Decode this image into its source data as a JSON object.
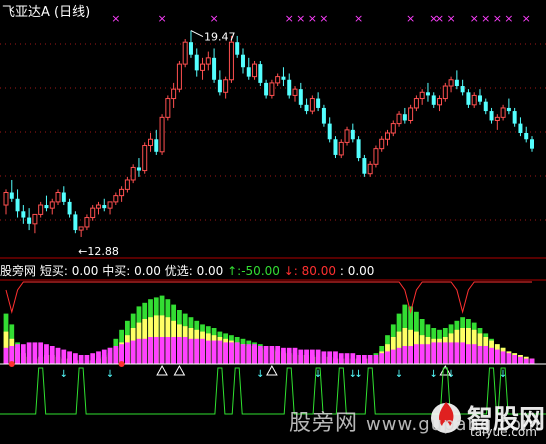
{
  "window": {
    "title": "飞亚达A (日线)"
  },
  "indicator_bar": {
    "name": "股旁网",
    "short_label": "短买:",
    "short_value": "0.00",
    "mid_label": "中买:",
    "mid_value": "0.00",
    "pick_label": "优选:",
    "pick_value": "0.00",
    "up_arrow": "↑",
    "up_value": ":-50.00",
    "down_arrow": "↓",
    "down_value": ": 80.00",
    "last_value": ": 0.00"
  },
  "watermark": {
    "site_cn": "股旁网",
    "site_url": "www.gupang.com",
    "brand_cn": "智股网",
    "brand_url": "taiyue.com"
  },
  "colors": {
    "up_candle": "#ff5050",
    "down_candle": "#54ffff",
    "magenta": "#ff40ff",
    "yellow": "#ffff66",
    "green": "#33dd33",
    "red_line": "#ff3030",
    "signal_line": "#30e030",
    "grid": "#a01818",
    "axis": "#b00000"
  },
  "chart_data": [
    {
      "type": "candlestick",
      "title": "飞亚达A (日线)",
      "annotations": [
        {
          "text": "19.47",
          "at_index": 32,
          "kind": "high"
        },
        {
          "text": "12.88",
          "at_index": 13,
          "kind": "low"
        }
      ],
      "top_markers_at": [
        19,
        27,
        36,
        49,
        51,
        53,
        55,
        61,
        70,
        74,
        75,
        77,
        81,
        83,
        85,
        87,
        90
      ],
      "candles": [
        [
          13.9,
          14.4,
          13.6,
          14.3
        ],
        [
          14.3,
          14.7,
          14.0,
          14.1
        ],
        [
          14.1,
          14.4,
          13.5,
          13.7
        ],
        [
          13.7,
          13.9,
          13.3,
          13.5
        ],
        [
          13.5,
          13.8,
          13.1,
          13.3
        ],
        [
          13.3,
          13.6,
          13.0,
          13.6
        ],
        [
          13.6,
          14.0,
          13.5,
          13.9
        ],
        [
          13.9,
          14.2,
          13.7,
          13.8
        ],
        [
          13.8,
          14.1,
          13.6,
          14.0
        ],
        [
          14.0,
          14.4,
          13.9,
          14.3
        ],
        [
          14.3,
          14.5,
          13.9,
          14.0
        ],
        [
          14.0,
          14.1,
          13.5,
          13.6
        ],
        [
          13.6,
          13.7,
          13.0,
          13.1
        ],
        [
          13.1,
          13.2,
          12.88,
          13.2
        ],
        [
          13.2,
          13.6,
          13.1,
          13.5
        ],
        [
          13.5,
          13.9,
          13.4,
          13.8
        ],
        [
          13.8,
          14.0,
          13.6,
          13.9
        ],
        [
          13.9,
          14.1,
          13.7,
          13.8
        ],
        [
          13.8,
          14.0,
          13.6,
          14.0
        ],
        [
          14.0,
          14.3,
          13.9,
          14.2
        ],
        [
          14.2,
          14.5,
          14.0,
          14.4
        ],
        [
          14.4,
          14.8,
          14.3,
          14.7
        ],
        [
          14.7,
          15.2,
          14.6,
          15.1
        ],
        [
          15.1,
          15.4,
          14.8,
          15.0
        ],
        [
          15.0,
          15.9,
          14.9,
          15.8
        ],
        [
          15.8,
          16.2,
          15.6,
          16.0
        ],
        [
          16.0,
          16.3,
          15.5,
          15.6
        ],
        [
          15.6,
          16.8,
          15.5,
          16.7
        ],
        [
          16.7,
          17.4,
          16.6,
          17.3
        ],
        [
          17.3,
          17.8,
          17.0,
          17.6
        ],
        [
          17.6,
          18.5,
          17.5,
          18.4
        ],
        [
          18.4,
          19.2,
          18.3,
          19.1
        ],
        [
          19.1,
          19.47,
          18.6,
          18.7
        ],
        [
          18.7,
          18.9,
          18.0,
          18.2
        ],
        [
          18.2,
          18.6,
          17.9,
          18.4
        ],
        [
          18.4,
          18.8,
          18.2,
          18.6
        ],
        [
          18.6,
          18.9,
          17.8,
          17.9
        ],
        [
          17.9,
          18.2,
          17.4,
          17.5
        ],
        [
          17.5,
          18.0,
          17.3,
          17.9
        ],
        [
          17.9,
          19.3,
          17.8,
          19.1
        ],
        [
          19.1,
          19.3,
          18.6,
          18.7
        ],
        [
          18.7,
          18.9,
          18.1,
          18.3
        ],
        [
          18.3,
          18.6,
          17.9,
          18.0
        ],
        [
          18.0,
          18.5,
          17.9,
          18.4
        ],
        [
          18.4,
          18.5,
          17.7,
          17.8
        ],
        [
          17.8,
          17.9,
          17.3,
          17.4
        ],
        [
          17.4,
          17.9,
          17.3,
          17.8
        ],
        [
          17.8,
          18.1,
          17.7,
          18.0
        ],
        [
          18.0,
          18.3,
          17.7,
          17.9
        ],
        [
          17.9,
          18.1,
          17.3,
          17.4
        ],
        [
          17.4,
          17.7,
          17.2,
          17.6
        ],
        [
          17.6,
          17.8,
          17.0,
          17.1
        ],
        [
          17.1,
          17.3,
          16.8,
          16.9
        ],
        [
          16.9,
          17.4,
          16.8,
          17.3
        ],
        [
          17.3,
          17.5,
          16.9,
          17.0
        ],
        [
          17.0,
          17.1,
          16.4,
          16.5
        ],
        [
          16.5,
          16.7,
          15.9,
          16.0
        ],
        [
          16.0,
          16.1,
          15.4,
          15.5
        ],
        [
          15.5,
          16.0,
          15.4,
          15.9
        ],
        [
          15.9,
          16.4,
          15.8,
          16.3
        ],
        [
          16.3,
          16.5,
          15.9,
          16.0
        ],
        [
          16.0,
          16.1,
          15.3,
          15.4
        ],
        [
          15.4,
          15.5,
          14.8,
          14.9
        ],
        [
          14.9,
          15.3,
          14.8,
          15.2
        ],
        [
          15.2,
          15.8,
          15.1,
          15.7
        ],
        [
          15.7,
          16.1,
          15.6,
          16.0
        ],
        [
          16.0,
          16.3,
          15.8,
          16.2
        ],
        [
          16.2,
          16.6,
          16.1,
          16.5
        ],
        [
          16.5,
          16.9,
          16.4,
          16.8
        ],
        [
          16.8,
          17.0,
          16.5,
          16.6
        ],
        [
          16.6,
          17.1,
          16.5,
          17.0
        ],
        [
          17.0,
          17.4,
          16.9,
          17.3
        ],
        [
          17.3,
          17.6,
          17.1,
          17.5
        ],
        [
          17.5,
          17.8,
          17.2,
          17.4
        ],
        [
          17.4,
          17.5,
          17.0,
          17.1
        ],
        [
          17.1,
          17.4,
          16.9,
          17.3
        ],
        [
          17.3,
          17.8,
          17.2,
          17.7
        ],
        [
          17.7,
          18.0,
          17.5,
          17.9
        ],
        [
          17.9,
          18.2,
          17.6,
          17.7
        ],
        [
          17.7,
          17.9,
          17.4,
          17.5
        ],
        [
          17.5,
          17.6,
          17.0,
          17.1
        ],
        [
          17.1,
          17.5,
          17.0,
          17.4
        ],
        [
          17.4,
          17.6,
          17.1,
          17.2
        ],
        [
          17.2,
          17.3,
          16.8,
          16.9
        ],
        [
          16.9,
          17.0,
          16.5,
          16.6
        ],
        [
          16.6,
          16.8,
          16.3,
          16.7
        ],
        [
          16.7,
          17.1,
          16.6,
          17.0
        ],
        [
          17.0,
          17.3,
          16.8,
          16.9
        ],
        [
          16.9,
          17.0,
          16.4,
          16.5
        ],
        [
          16.5,
          16.7,
          16.1,
          16.2
        ],
        [
          16.2,
          16.4,
          15.9,
          16.0
        ],
        [
          16.0,
          16.1,
          15.6,
          15.7
        ]
      ]
    },
    {
      "type": "bar",
      "title": "股旁网",
      "ylim": [
        0,
        100
      ],
      "series": [
        {
          "name": "短买",
          "color_key": "green",
          "values": [
            28,
            22,
            12,
            6,
            4,
            3,
            4,
            5,
            5,
            4,
            3,
            3,
            2,
            2,
            2,
            2,
            3,
            5,
            9,
            14,
            19,
            24,
            28,
            32,
            34,
            36,
            37,
            38,
            36,
            33,
            30,
            28,
            26,
            24,
            22,
            21,
            20,
            18,
            17,
            16,
            15,
            14,
            13,
            12,
            11,
            10,
            9,
            8,
            7,
            6,
            6,
            5,
            5,
            5,
            4,
            4,
            4,
            3,
            3,
            3,
            3,
            3,
            3,
            3,
            6,
            10,
            16,
            22,
            28,
            33,
            32,
            29,
            25,
            22,
            20,
            19,
            20,
            22,
            24,
            26,
            25,
            23,
            20,
            17,
            14,
            11,
            9,
            7,
            6,
            5,
            4,
            3
          ]
        },
        {
          "name": "中买",
          "color_key": "yellow",
          "values": [
            18,
            14,
            9,
            6,
            4,
            3,
            4,
            5,
            5,
            4,
            3,
            3,
            2,
            2,
            2,
            2,
            3,
            4,
            6,
            9,
            12,
            16,
            20,
            23,
            25,
            26,
            27,
            27,
            26,
            24,
            22,
            21,
            20,
            19,
            18,
            17,
            16,
            15,
            14,
            13,
            12,
            11,
            10,
            10,
            9,
            8,
            8,
            7,
            6,
            6,
            5,
            5,
            5,
            4,
            4,
            4,
            4,
            3,
            3,
            3,
            3,
            3,
            3,
            3,
            4,
            7,
            11,
            15,
            18,
            20,
            19,
            18,
            16,
            15,
            14,
            14,
            15,
            17,
            19,
            20,
            20,
            19,
            17,
            15,
            13,
            11,
            9,
            7,
            6,
            5,
            4,
            3
          ]
        },
        {
          "name": "优选",
          "color_key": "magenta",
          "values": [
            9,
            10,
            11,
            11,
            12,
            12,
            12,
            11,
            10,
            9,
            8,
            7,
            6,
            5,
            5,
            6,
            7,
            8,
            9,
            10,
            11,
            12,
            13,
            14,
            14,
            15,
            15,
            15,
            15,
            15,
            15,
            15,
            14,
            14,
            14,
            13,
            13,
            13,
            12,
            12,
            12,
            11,
            11,
            11,
            10,
            10,
            10,
            10,
            9,
            9,
            9,
            8,
            8,
            8,
            8,
            7,
            7,
            7,
            6,
            6,
            6,
            5,
            5,
            5,
            5,
            6,
            7,
            8,
            9,
            10,
            10,
            11,
            11,
            11,
            12,
            12,
            12,
            12,
            12,
            12,
            11,
            11,
            10,
            10,
            9,
            8,
            7,
            6,
            5,
            4,
            3,
            3
          ]
        }
      ],
      "red_line_dips_at": [
        1,
        70,
        79
      ],
      "up_arrows_at": [
        10,
        18,
        44,
        54,
        60,
        61,
        68,
        74,
        77,
        86
      ],
      "triangles_at": [
        27,
        30,
        46,
        76
      ],
      "red_dots_at": [
        1,
        20
      ],
      "signal_pulses_at": [
        6,
        13,
        37,
        40,
        49,
        54,
        58,
        63,
        76,
        84,
        86
      ]
    }
  ]
}
